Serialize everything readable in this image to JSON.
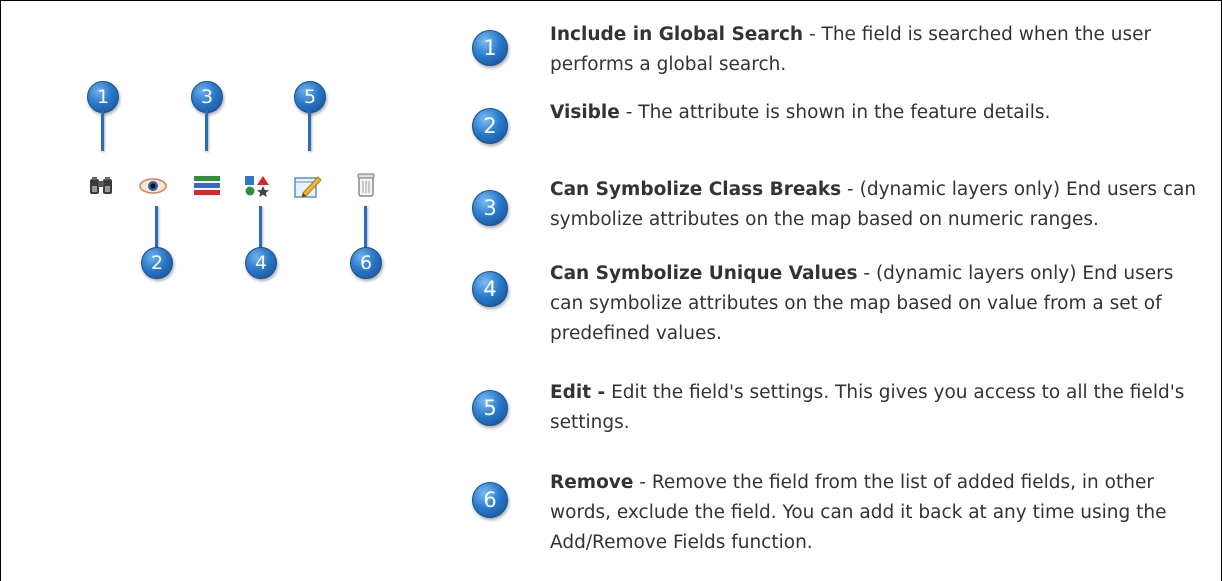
{
  "diagram": {
    "top_badges": [
      "1",
      "3",
      "5"
    ],
    "bottom_badges": [
      "2",
      "4",
      "6"
    ],
    "icons": [
      "binoculars-icon",
      "eye-icon",
      "color-bars-icon",
      "shapes-icon",
      "edit-pencil-icon",
      "trash-can-icon"
    ]
  },
  "items": [
    {
      "number": "1",
      "title": "Include in Global Search",
      "sep": " - ",
      "text": "The field is searched when the user performs a global search."
    },
    {
      "number": "2",
      "title": "Visible",
      "sep": " - ",
      "text": "The attribute is shown in the feature details."
    },
    {
      "number": "3",
      "title": "Can Symbolize Class Breaks",
      "sep": " - ",
      "text": "(dynamic layers only) End users can symbolize attributes on the map based on numeric ranges."
    },
    {
      "number": "4",
      "title": "Can Symbolize Unique Values",
      "sep": " - ",
      "text": "(dynamic layers only) End users can symbolize attributes on the map based on value from a set of predefined values."
    },
    {
      "number": "5",
      "title": "Edit -",
      "sep": " ",
      "text": "Edit the field's settings. This gives you access to all the field's settings."
    },
    {
      "number": "6",
      "title": "Remove",
      "sep": " - ",
      "text": "Remove the field from the list of added fields, in other words, exclude the field. You can add it back at any time using the Add/Remove Fields function."
    }
  ]
}
